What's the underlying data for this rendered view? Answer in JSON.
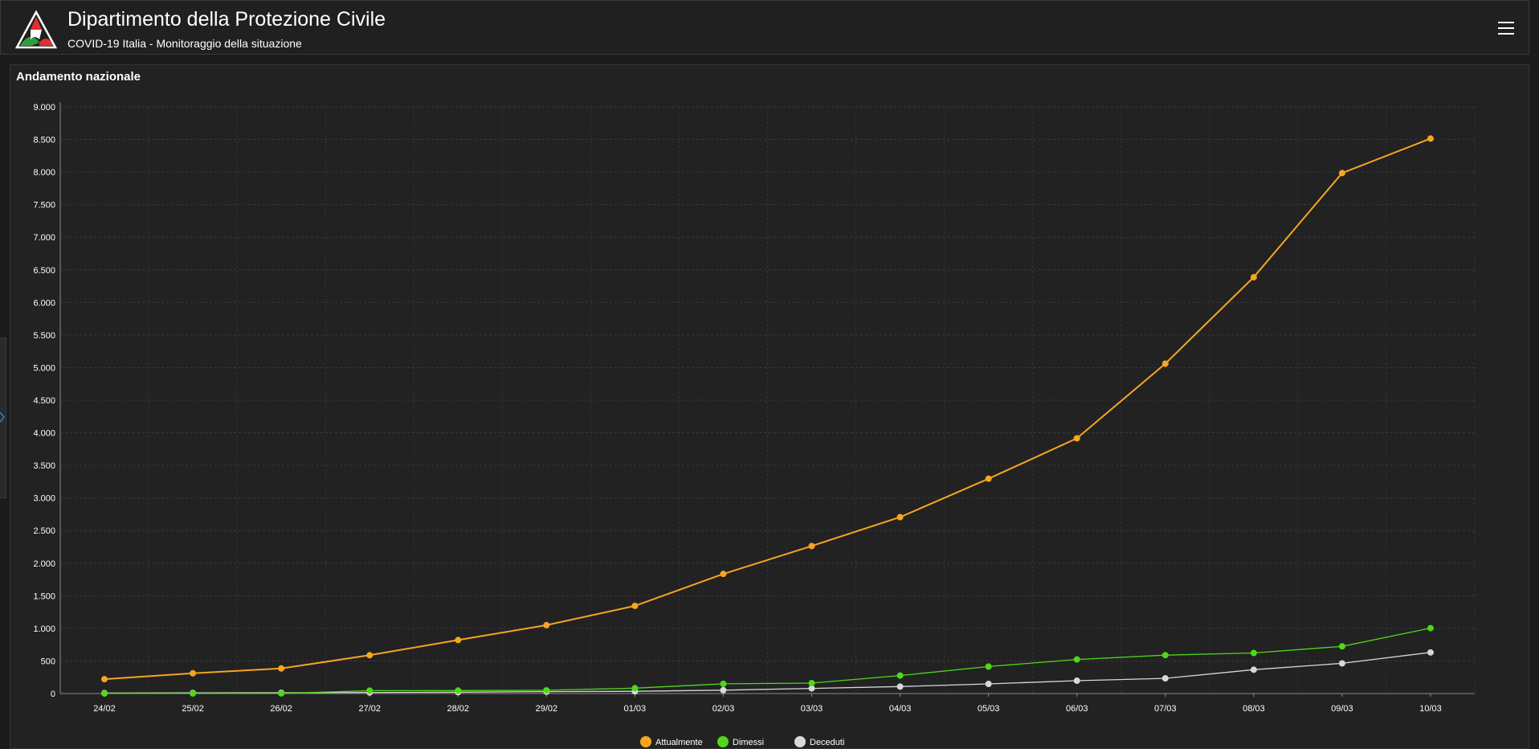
{
  "header": {
    "title": "Dipartimento della Protezione Civile",
    "subtitle": "COVID-19 Italia - Monitoraggio della situazione",
    "menu_icon": "hamburger-menu-icon",
    "logo_icon": "protezione-civile-logo-icon"
  },
  "panel": {
    "title": "Andamento nazionale"
  },
  "colors": {
    "background": "#1b1b1b",
    "panel": "#222222",
    "attualmente": "#f7a520",
    "dimessi": "#4fd81a",
    "deceduti": "#d8d8d8"
  },
  "chart_data": {
    "type": "line",
    "title": "Andamento nazionale",
    "xlabel": "",
    "ylabel": "",
    "ylim": [
      0,
      9000
    ],
    "ytick_step": 500,
    "ytick_labels": [
      "0",
      "500",
      "1.000",
      "1.500",
      "2.000",
      "2.500",
      "3.000",
      "3.500",
      "4.000",
      "4.500",
      "5.000",
      "5.500",
      "6.000",
      "6.500",
      "7.000",
      "7.500",
      "8.000",
      "8.500",
      "9.000"
    ],
    "grid": true,
    "legend_position": "bottom-center",
    "categories": [
      "24/02",
      "25/02",
      "26/02",
      "27/02",
      "28/02",
      "29/02",
      "01/03",
      "02/03",
      "03/03",
      "04/03",
      "05/03",
      "06/03",
      "07/03",
      "08/03",
      "09/03",
      "10/03"
    ],
    "series": [
      {
        "name": "Attualmente",
        "color": "#f7a520",
        "values": [
          221,
          311,
          385,
          588,
          821,
          1049,
          1345,
          1835,
          2263,
          2706,
          3296,
          3916,
          5061,
          6387,
          7985,
          8514
        ]
      },
      {
        "name": "Dimessi",
        "color": "#4fd81a",
        "values": [
          1,
          1,
          3,
          45,
          46,
          50,
          83,
          149,
          160,
          276,
          414,
          523,
          589,
          622,
          724,
          1004
        ]
      },
      {
        "name": "Deceduti",
        "color": "#d8d8d8",
        "values": [
          7,
          10,
          12,
          17,
          21,
          29,
          34,
          52,
          79,
          107,
          148,
          197,
          233,
          366,
          463,
          631
        ]
      }
    ]
  }
}
